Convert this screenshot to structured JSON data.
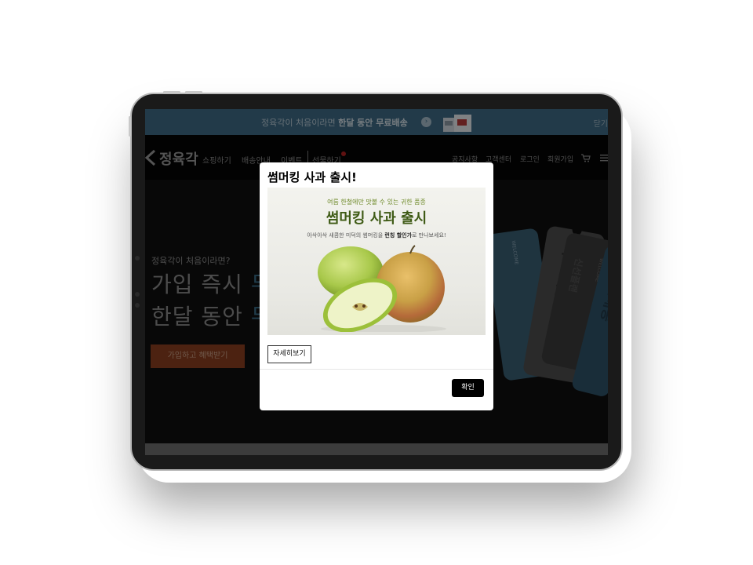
{
  "promo": {
    "text_prefix": "정육각이 처음이라면 ",
    "text_bold": "한달 동안 무료배송",
    "arrow_icon": "chevron-right-icon",
    "close_label": "닫기"
  },
  "nav": {
    "logo": "정육각",
    "left_items": [
      "쇼핑하기",
      "배송안내",
      "이벤트",
      "선물하기"
    ],
    "right_items": [
      "공지사항",
      "고객센터",
      "로그인",
      "회원가입"
    ],
    "cart_icon": "cart-icon",
    "menu_icon": "hamburger-menu-icon"
  },
  "hero": {
    "subtitle": "정육각이 처음이라면?",
    "line1": "가입 즉시 ",
    "line1_highlight": "무",
    "line2": "한달 동안 ",
    "line2_highlight": "무",
    "cta": "가입하고 혜택받기",
    "card_text_1": "WELCOME",
    "card_text_2": "무료배송",
    "card_text_3": "신선플랜",
    "card_text_4": "WELCOME",
    "card_text_5": "무료배송"
  },
  "modal": {
    "title": "썸머킹 사과 출시!",
    "banner": {
      "kicker": "여름 한철에만 맛볼 수 있는 귀한 품종",
      "headline": "썸머킹 사과 출시",
      "desc_prefix": "아삭아삭 새콤한 미덕의 썸머킹을 ",
      "desc_bold": "런칭 할인가",
      "desc_suffix": "로 만나보세요!"
    },
    "detail_button": "자세히보기",
    "ok_button": "확인"
  },
  "colors": {
    "promo_bg": "#3e6b85",
    "cta_bg": "#8a3e1f",
    "headline_green": "#3f5b16",
    "ok_bg": "#000000"
  }
}
